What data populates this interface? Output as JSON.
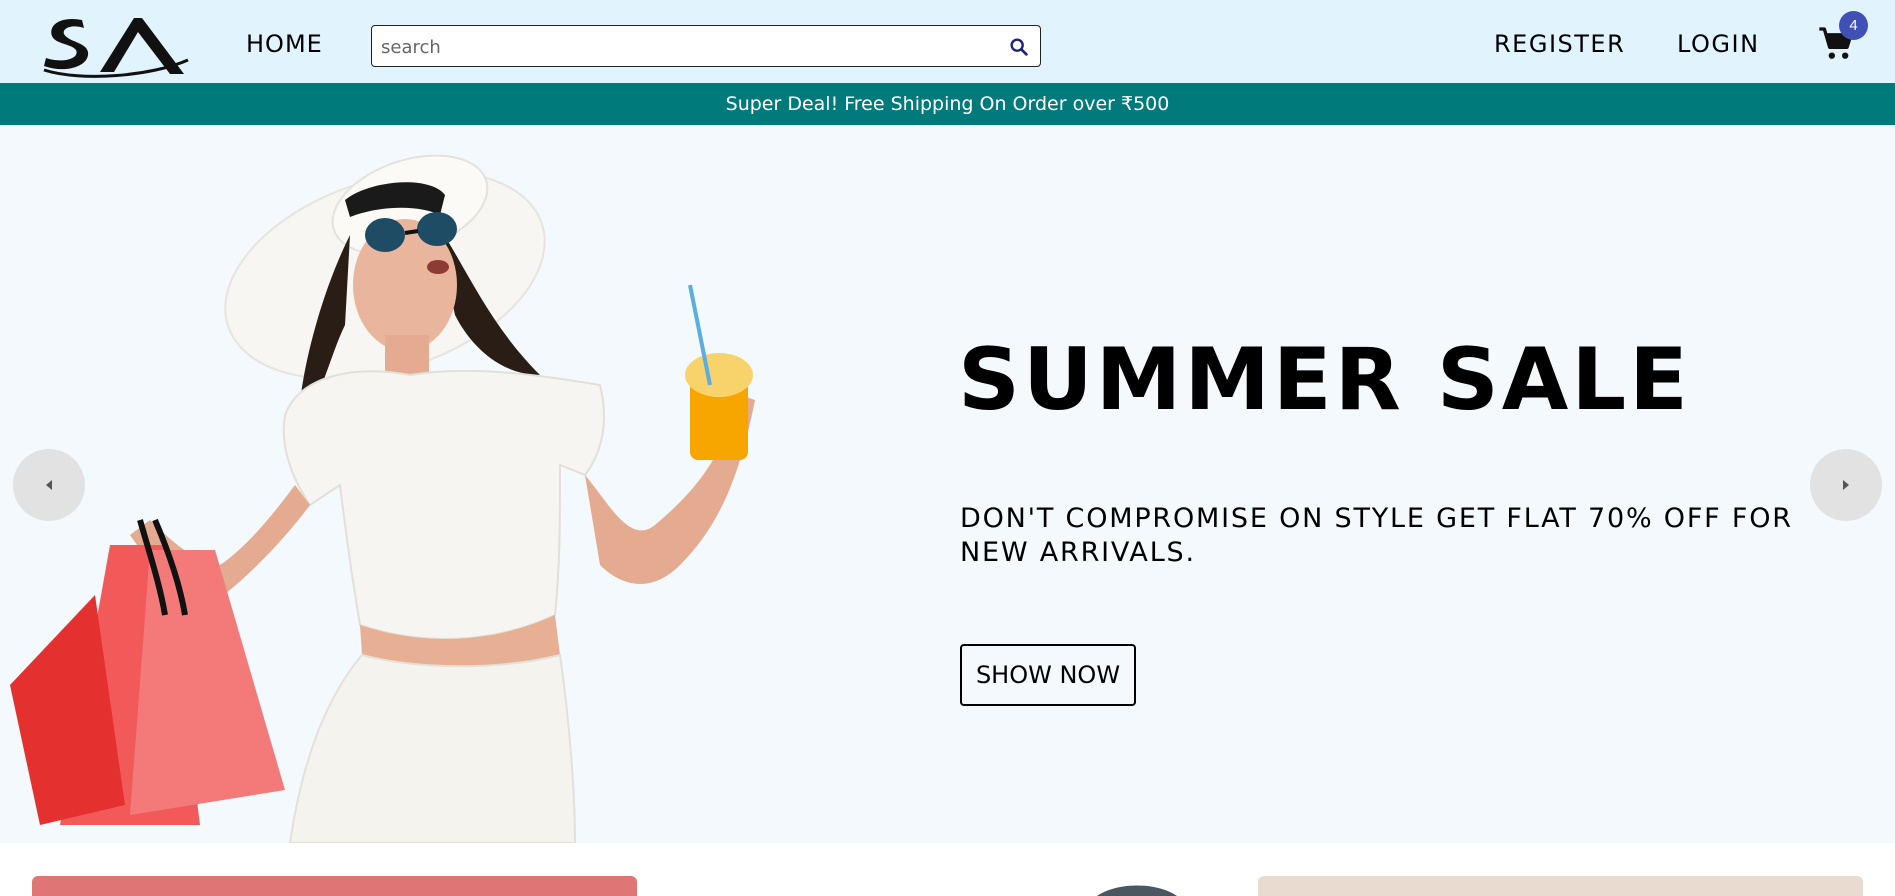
{
  "header": {
    "logo_alt": "SA",
    "nav": {
      "home": "HOME",
      "register": "REGISTER",
      "login": "LOGIN"
    },
    "search": {
      "placeholder": "search",
      "value": ""
    },
    "cart": {
      "count": "4"
    }
  },
  "announcement": {
    "text": "Super Deal! Free Shipping On Order over ₹500"
  },
  "hero": {
    "title": "SUMMER SALE",
    "description": "DON'T COMPROMISE ON STYLE GET FLAT 70% OFF FOR NEW ARRIVALS.",
    "button_label": "SHOW NOW"
  },
  "icons": {
    "search": "search-icon",
    "cart": "cart-icon",
    "prev": "arrow-left-icon",
    "next": "arrow-right-icon"
  },
  "colors": {
    "header_bg": "#e1f3fd",
    "announcement_bg": "#007a7a",
    "slider_bg": "#f3f9fc",
    "badge": "#3f51b5"
  }
}
